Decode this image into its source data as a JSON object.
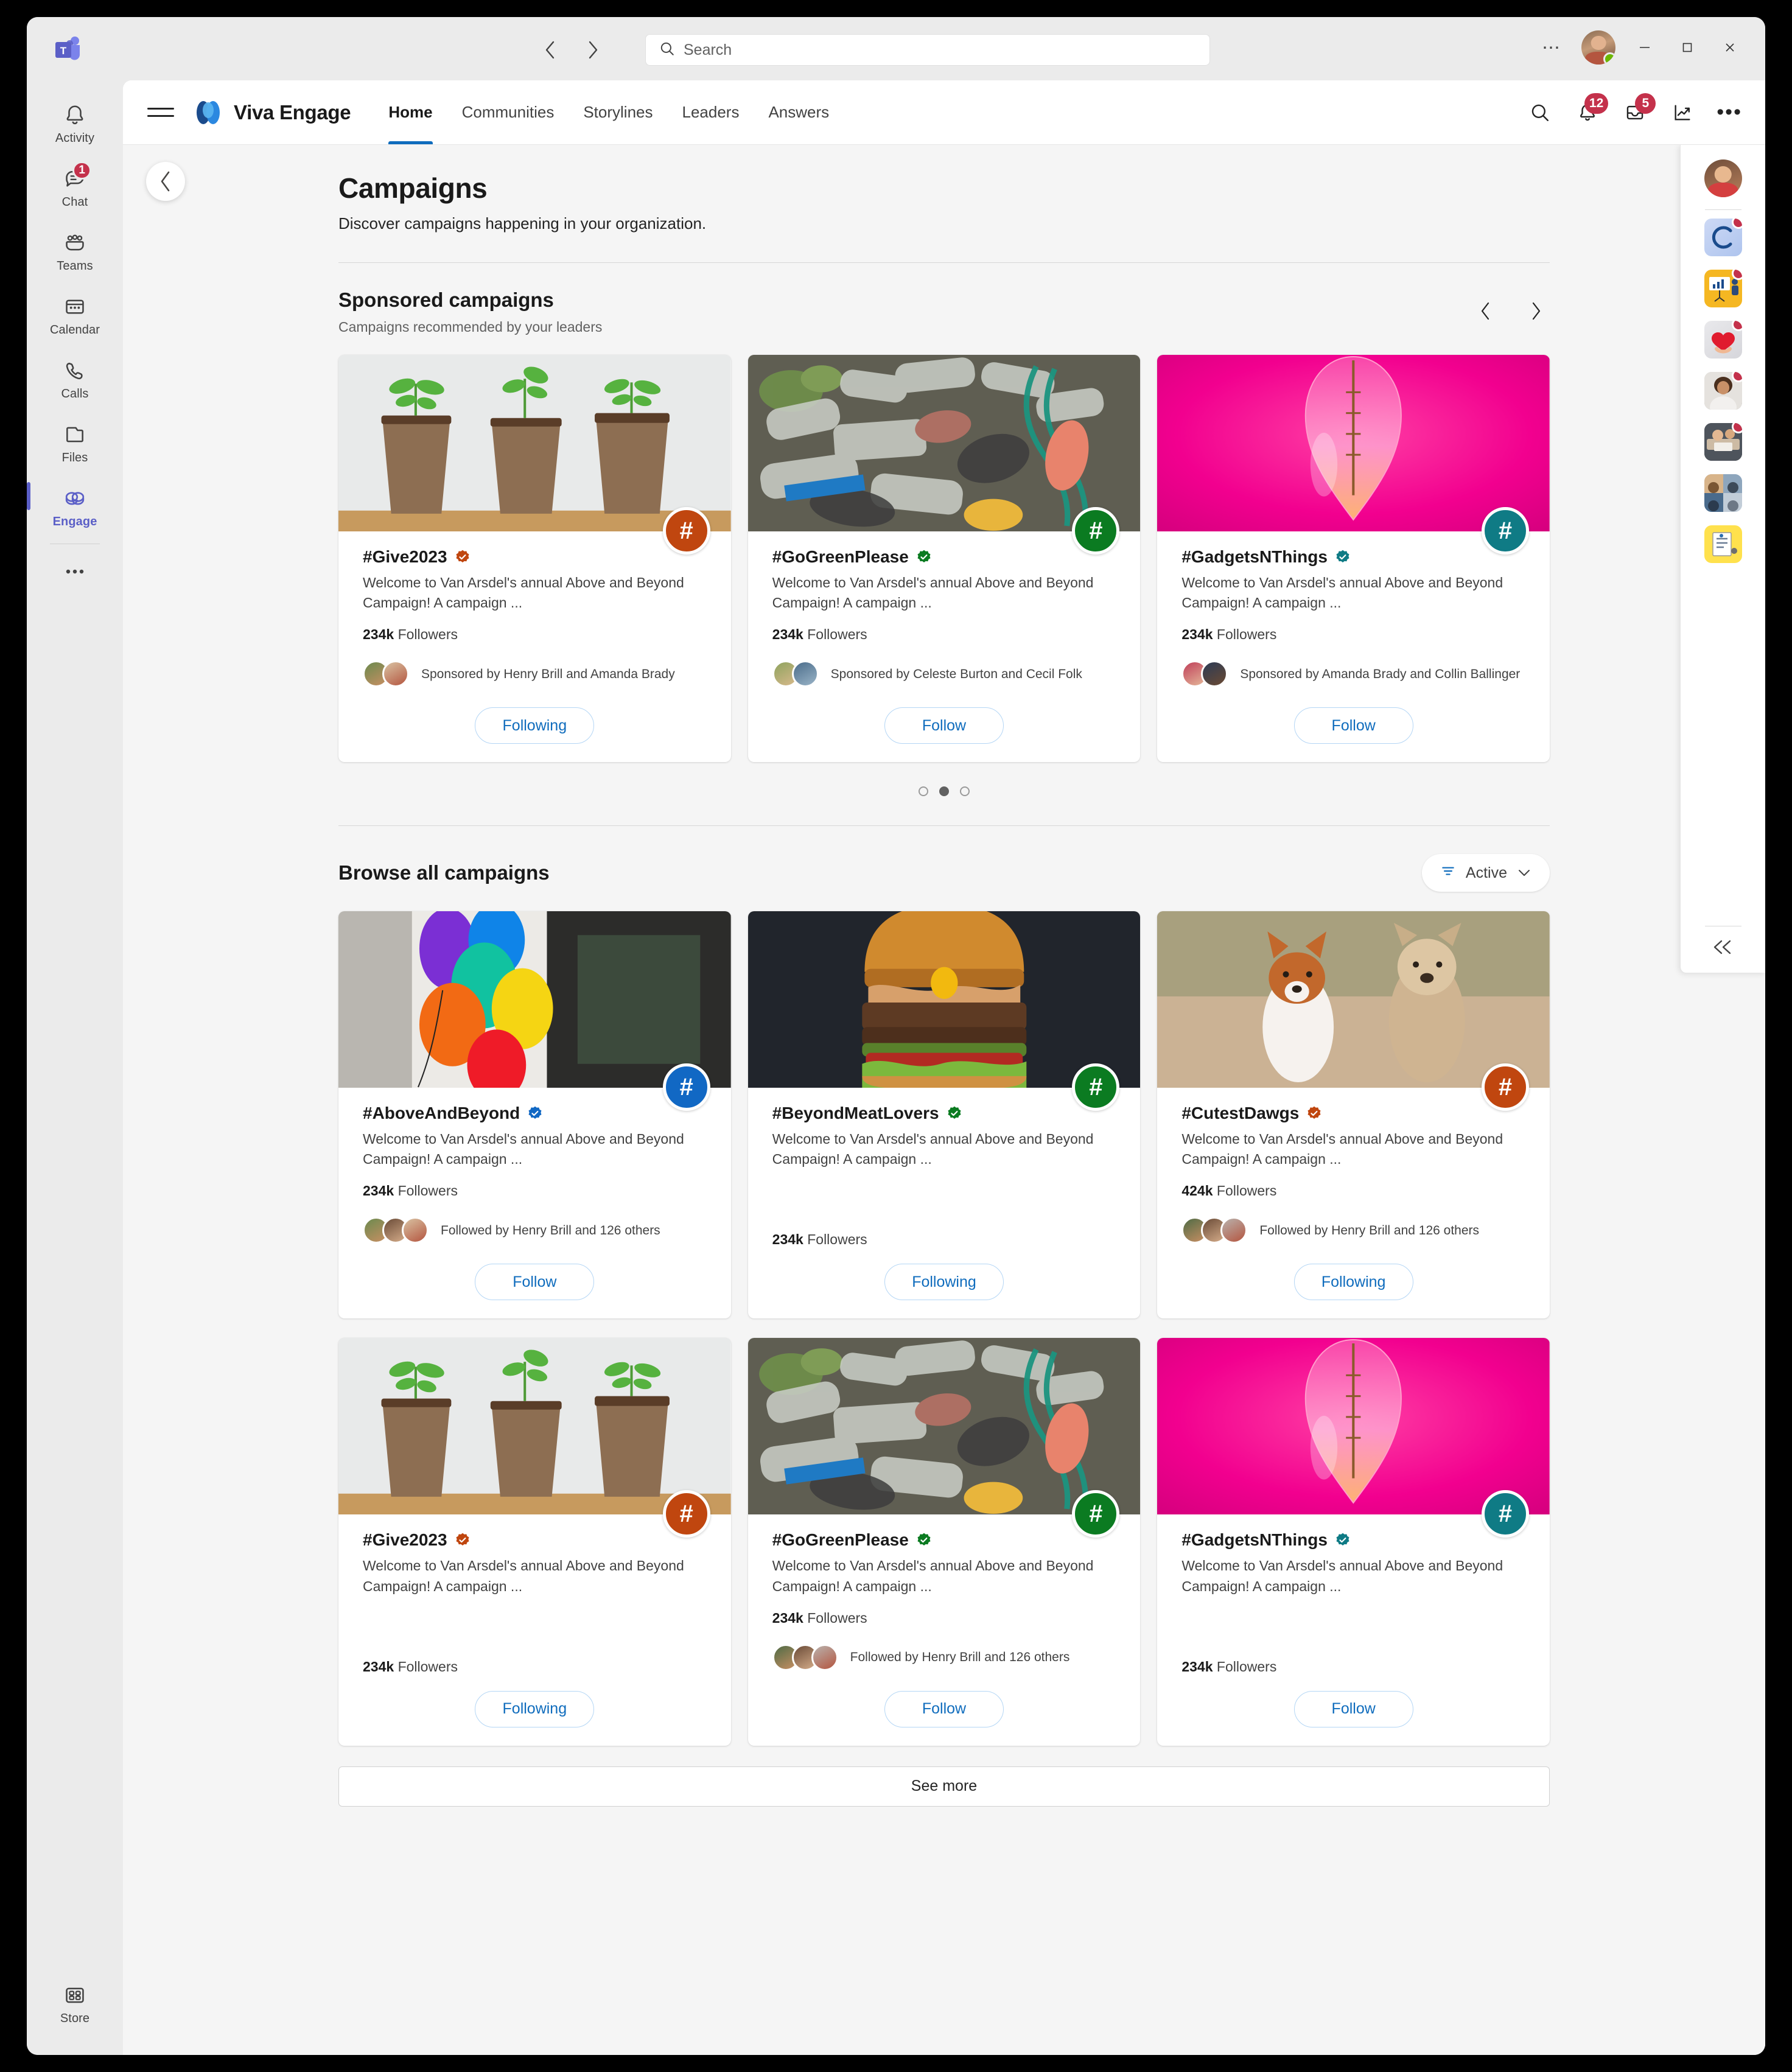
{
  "titlebar": {
    "app_icon": "teams-logo",
    "back_arrow": "‹",
    "forward_arrow": "›",
    "search_placeholder": "Search",
    "overflow": "⋯",
    "minimize": "minimize-icon",
    "maximize": "maximize-icon",
    "close": "close-icon"
  },
  "rail": {
    "items": [
      {
        "label": "Activity",
        "icon": "bell-icon",
        "badge": "",
        "active": false
      },
      {
        "label": "Chat",
        "icon": "chat-icon",
        "badge": "1",
        "active": false
      },
      {
        "label": "Teams",
        "icon": "teams-icon",
        "badge": "",
        "active": false
      },
      {
        "label": "Calendar",
        "icon": "calendar-icon",
        "badge": "",
        "active": false
      },
      {
        "label": "Calls",
        "icon": "phone-icon",
        "badge": "",
        "active": false
      },
      {
        "label": "Files",
        "icon": "file-icon",
        "badge": "",
        "active": false
      },
      {
        "label": "Engage",
        "icon": "engage-icon",
        "badge": "",
        "active": true
      }
    ],
    "more_label": "•••",
    "store": {
      "label": "Store",
      "icon": "store-icon"
    }
  },
  "appheader": {
    "menu_icon": "hamburger-icon",
    "brand": "Viva Engage",
    "nav": [
      {
        "label": "Home",
        "active": true
      },
      {
        "label": "Communities",
        "active": false
      },
      {
        "label": "Storylines",
        "active": false
      },
      {
        "label": "Leaders",
        "active": false
      },
      {
        "label": "Answers",
        "active": false
      }
    ],
    "actions": [
      {
        "name": "search-icon",
        "badge": ""
      },
      {
        "name": "bell-icon",
        "badge": "12"
      },
      {
        "name": "inbox-icon",
        "badge": "5"
      },
      {
        "name": "analytics-icon",
        "badge": ""
      }
    ],
    "overflow": "•••"
  },
  "page": {
    "back_button": "‹",
    "title": "Campaigns",
    "subtitle": "Discover campaigns happening in your organization."
  },
  "sponsored": {
    "title": "Sponsored campaigns",
    "subtitle": "Campaigns recommended by your leaders",
    "prev": "‹",
    "next": "›",
    "pagination": {
      "count": 3,
      "active_index": 1
    },
    "cards": [
      {
        "name": "#Give2023",
        "verified": true,
        "accent": "#c0460f",
        "image": "seedlings-in-pots",
        "description": "Welcome to Van Arsdel's annual Above and Beyond Campaign! A campaign ...",
        "followers_count": "234k",
        "followers_label": "Followers",
        "attribution": "Sponsored by Henry Brill and Amanda Brady",
        "faces": 2,
        "button": "Following"
      },
      {
        "name": "#GoGreenPlease",
        "verified": true,
        "accent": "#0b7b21",
        "image": "plastic-bottles-waste",
        "description": "Welcome to Van Arsdel's annual Above and Beyond Campaign! A campaign ...",
        "followers_count": "234k",
        "followers_label": "Followers",
        "attribution": "Sponsored by Celeste Burton and Cecil Folk",
        "faces": 2,
        "button": "Follow"
      },
      {
        "name": "#GadgetsNThings",
        "verified": true,
        "accent": "#0f7b85",
        "image": "pink-lightbulb",
        "description": "Welcome to Van Arsdel's annual Above and Beyond Campaign! A campaign ...",
        "followers_count": "234k",
        "followers_label": "Followers",
        "attribution": "Sponsored by Amanda Brady and Collin Ballinger",
        "faces": 2,
        "button": "Follow"
      }
    ]
  },
  "browse": {
    "title": "Browse all campaigns",
    "filter_label": "Active",
    "filter_icon": "filter-icon",
    "chevron": "⌄",
    "see_more": "See more",
    "cards": [
      {
        "name": "#AboveAndBeyond",
        "verified": true,
        "accent": "#1168c4",
        "image": "colorful-balloons",
        "description": "Welcome to Van Arsdel's annual Above and Beyond Campaign! A campaign ...",
        "followers_count": "234k",
        "followers_label": "Followers",
        "attribution": "Followed by Henry Brill and 126 others",
        "faces": 3,
        "button": "Follow"
      },
      {
        "name": "#BeyondMeatLovers",
        "verified": true,
        "accent": "#0b7b21",
        "image": "cheeseburger",
        "description": "Welcome to Van Arsdel's annual Above and Beyond Campaign! A campaign ...",
        "followers_count": "234k",
        "followers_label": "Followers",
        "attribution": "",
        "faces": 0,
        "button": "Following"
      },
      {
        "name": "#CutestDawgs",
        "verified": true,
        "accent": "#c0460f",
        "image": "two-dogs-running",
        "description": "Welcome to Van Arsdel's annual Above and Beyond Campaign! A campaign ...",
        "followers_count": "424k",
        "followers_label": "Followers",
        "attribution": "Followed by Henry Brill and 126 others",
        "faces": 3,
        "button": "Following"
      },
      {
        "name": "#Give2023",
        "verified": true,
        "accent": "#c0460f",
        "image": "seedlings-in-pots",
        "description": "Welcome to Van Arsdel's annual Above and Beyond Campaign! A campaign ...",
        "followers_count": "234k",
        "followers_label": "Followers",
        "attribution": "",
        "faces": 0,
        "button": "Following"
      },
      {
        "name": "#GoGreenPlease",
        "verified": true,
        "accent": "#0b7b21",
        "image": "plastic-bottles-waste",
        "description": "Welcome to Van Arsdel's annual Above and Beyond Campaign! A campaign ...",
        "followers_count": "234k",
        "followers_label": "Followers",
        "attribution": "Followed by Henry Brill and 126 others",
        "faces": 3,
        "button": "Follow"
      },
      {
        "name": "#GadgetsNThings",
        "verified": true,
        "accent": "#0f7b85",
        "image": "pink-lightbulb",
        "description": "Welcome to Van Arsdel's annual Above and Beyond Campaign! A campaign ...",
        "followers_count": "234k",
        "followers_label": "Followers",
        "attribution": "",
        "faces": 0,
        "button": "Follow"
      }
    ]
  },
  "right_panel": {
    "avatar": "user-avatar",
    "apps": [
      {
        "name": "viva-connections-app",
        "badge": true
      },
      {
        "name": "viva-insights-app",
        "badge": true
      },
      {
        "name": "praise-app",
        "badge": true
      },
      {
        "name": "video-person-app",
        "badge": true
      },
      {
        "name": "meeting-app",
        "badge": true
      },
      {
        "name": "people-grid-app",
        "badge": false
      },
      {
        "name": "notes-app",
        "badge": false
      }
    ],
    "collapse": "«"
  }
}
